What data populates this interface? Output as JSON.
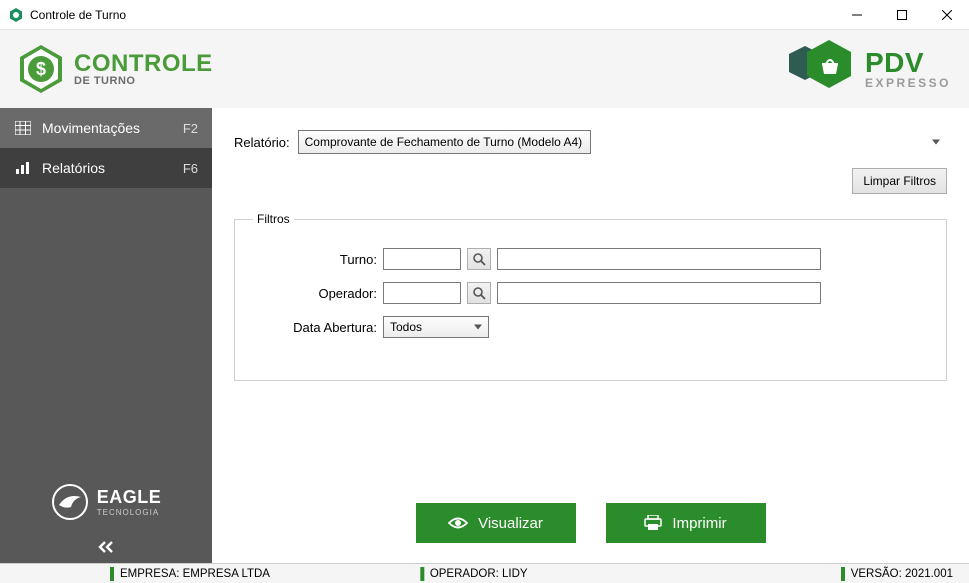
{
  "window": {
    "title": "Controle de Turno"
  },
  "branding": {
    "left": {
      "title": "CONTROLE",
      "subtitle": "DE TURNO"
    },
    "right": {
      "title": "PDV",
      "subtitle": "EXPRESSO"
    }
  },
  "sidebar": {
    "items": [
      {
        "label": "Movimentações",
        "shortcut": "F2"
      },
      {
        "label": "Relatórios",
        "shortcut": "F6"
      }
    ],
    "footer": {
      "title": "EAGLE",
      "subtitle": "TECNOLOGIA"
    }
  },
  "main": {
    "report_label": "Relatório:",
    "report_value": "Comprovante de Fechamento de Turno (Modelo A4)",
    "clear_filters_label": "Limpar Filtros",
    "filters_legend": "Filtros",
    "turno_label": "Turno:",
    "turno_code": "",
    "turno_desc": "",
    "operador_label": "Operador:",
    "operador_code": "",
    "operador_desc": "",
    "data_abertura_label": "Data Abertura:",
    "data_abertura_value": "Todos",
    "visualizar_label": "Visualizar",
    "imprimir_label": "Imprimir"
  },
  "statusbar": {
    "empresa_label": "EMPRESA:",
    "empresa_value": "EMPRESA LTDA",
    "operador_label": "OPERADOR:",
    "operador_value": "LIDY",
    "versao_label": "VERSÃO:",
    "versao_value": "2021.001"
  }
}
